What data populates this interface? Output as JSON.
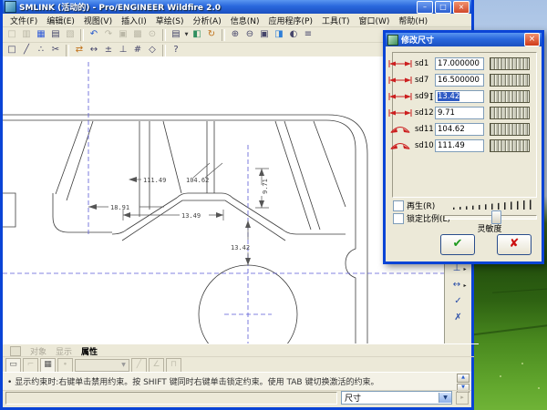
{
  "window": {
    "title": "SMLINK (活动的) - Pro/ENGINEER Wildfire 2.0",
    "controls": {
      "minimize": "–",
      "maximize": "□",
      "close": "×"
    }
  },
  "menus": [
    "文件(F)",
    "编辑(E)",
    "视图(V)",
    "插入(I)",
    "草绘(S)",
    "分析(A)",
    "信息(N)",
    "应用程序(P)",
    "工具(T)",
    "窗口(W)",
    "帮助(H)"
  ],
  "toolbar_main": [
    {
      "name": "new",
      "glyph": "□"
    },
    {
      "name": "open",
      "glyph": "▥"
    },
    {
      "name": "save",
      "glyph": "▦"
    },
    {
      "name": "print",
      "glyph": "▤"
    },
    {
      "name": "export",
      "glyph": "▧"
    },
    {
      "name": "undo",
      "glyph": "↶"
    },
    {
      "name": "redo",
      "glyph": "↷"
    },
    {
      "name": "copy",
      "glyph": "▣"
    },
    {
      "name": "paste",
      "glyph": "▩"
    },
    {
      "name": "search",
      "glyph": "⊙"
    },
    {
      "name": "model-tree",
      "glyph": "▤"
    },
    {
      "name": "view-manager",
      "glyph": "◧"
    },
    {
      "name": "regenerate",
      "glyph": "↻"
    },
    {
      "name": "zoom-in",
      "glyph": "⊕"
    },
    {
      "name": "zoom-out",
      "glyph": "⊖"
    },
    {
      "name": "refit",
      "glyph": "▣"
    },
    {
      "name": "repaint",
      "glyph": "◨"
    },
    {
      "name": "shaded-view",
      "glyph": "◐"
    },
    {
      "name": "layers",
      "glyph": "≡"
    }
  ],
  "toolbar_sketch": [
    {
      "name": "select",
      "glyph": "□"
    },
    {
      "name": "line",
      "glyph": "╱"
    },
    {
      "name": "point",
      "glyph": "∴"
    },
    {
      "name": "trim",
      "glyph": "✂"
    },
    {
      "name": "swap",
      "glyph": "⇄"
    },
    {
      "name": "dimension",
      "glyph": "↔"
    },
    {
      "name": "modify",
      "glyph": "±"
    },
    {
      "name": "constraints",
      "glyph": "⊥"
    },
    {
      "name": "grid",
      "glyph": "#"
    },
    {
      "name": "feature-tools",
      "glyph": "◇"
    },
    {
      "name": "context-help",
      "glyph": "?"
    }
  ],
  "right_toolbar": [
    {
      "name": "constraint-tool",
      "glyph": "⊥",
      "flyout": "▸"
    },
    {
      "name": "dimension-tool",
      "glyph": "↔",
      "flyout": "▸"
    },
    {
      "name": "accept-sketch",
      "glyph": "✓"
    },
    {
      "name": "quit-sketch",
      "glyph": "✗"
    }
  ],
  "dialog": {
    "title": "修改尺寸",
    "close": "×",
    "rows": [
      {
        "name": "sd1",
        "value": "17.000000",
        "type": "linear"
      },
      {
        "name": "sd7",
        "value": "16.500000",
        "type": "linear"
      },
      {
        "name": "sd9",
        "value": "13.42",
        "type": "linear",
        "selected": true
      },
      {
        "name": "sd12",
        "value": "9.71",
        "type": "linear"
      },
      {
        "name": "sd11",
        "value": "104.62",
        "type": "angular"
      },
      {
        "name": "sd10",
        "value": "111.49",
        "type": "angular"
      }
    ],
    "regen_label": "再生(R)",
    "lock_label": "锁定比例(L)",
    "sensitivity_label": "灵敏度",
    "ok_glyph": "✔",
    "cancel_glyph": "✘"
  },
  "sketch": {
    "dim_left": "18.91",
    "dim_angle1": "111.49",
    "dim_angle2": "104.62",
    "dim_height": "9.71",
    "dim_width": "13.49",
    "dim_circle": "13.42"
  },
  "bottom": {
    "tabs": [
      {
        "label": "对象"
      },
      {
        "label": "显示"
      },
      {
        "label": "属性"
      }
    ],
    "bullet": "•",
    "message": "显示约束时:右键单击禁用约束。按 SHIFT 键同时右键单击锁定约束。使用 TAB 键切换激活的约束。",
    "scroll_up": "▲",
    "scroll_down": "▼",
    "status_combo": "尺寸",
    "combo_arrow": "▼"
  }
}
